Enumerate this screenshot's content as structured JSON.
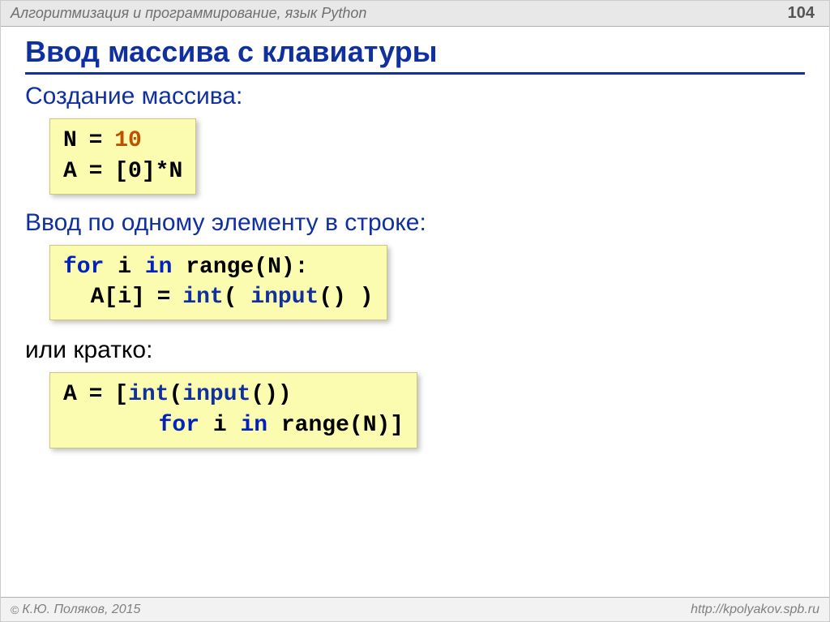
{
  "header": {
    "subject": "Алгоритмизация и программирование, язык Python",
    "page": "104"
  },
  "title": "Ввод массива с клавиатуры",
  "sections": {
    "s1": "Создание массива:",
    "s2": "Ввод по одному элементу в строке:",
    "s3": "или кратко:"
  },
  "code1": {
    "n_eq": "N",
    "eq1": "=",
    "ten": "10",
    "a_eq": "A",
    "eq2": "=",
    "zero_part": "[0]*N"
  },
  "code2": {
    "for": "for",
    "i": " i ",
    "in": "in",
    "range_n": " range(N):",
    "ai_eq": "  A[i]",
    "eq": "=",
    "int": "int",
    "paren_open": "( ",
    "input": "input",
    "paren_close": "() )"
  },
  "code3": {
    "a": "A",
    "eq": "=",
    "open": "[",
    "int": "int",
    "po": "(",
    "input": "input",
    "pc": "())",
    "indent": "       ",
    "for": "for",
    "i": " i ",
    "in": "in",
    "rest": " range(N)]"
  },
  "footer": {
    "copyright": "К.Ю. Поляков, 2015",
    "url": "http://kpolyakov.spb.ru"
  }
}
